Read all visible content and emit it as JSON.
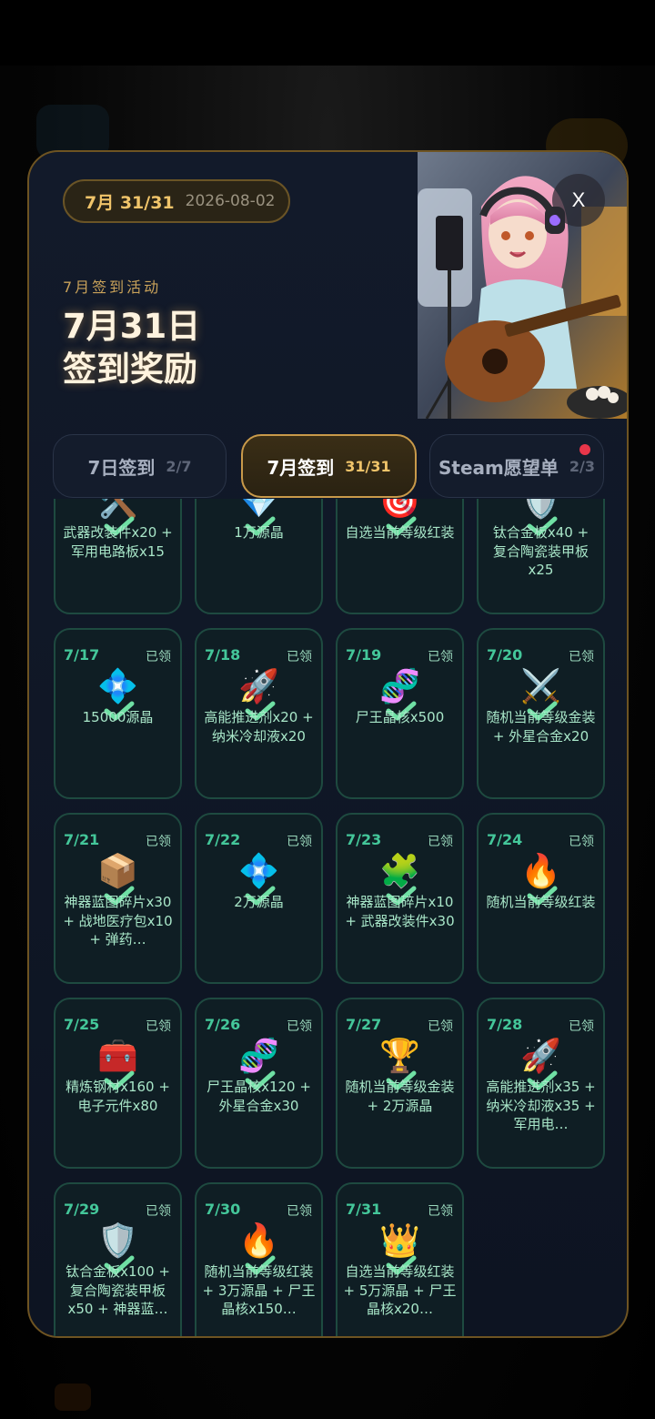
{
  "dialog": {
    "close_label": "X",
    "date_pill": {
      "month_progress": "7月 31/31",
      "date": "2026-08-02"
    },
    "event_label": "7月签到活动",
    "title_line1": "7月31日",
    "title_line2": "签到奖励"
  },
  "tabs": [
    {
      "label": "7日签到",
      "count": "2/7",
      "active": false
    },
    {
      "label": "7月签到",
      "count": "31/31",
      "active": true
    },
    {
      "label": "Steam愿望单",
      "count": "2/3",
      "active": false,
      "has_notification_dot": true
    }
  ],
  "colors": {
    "accent_gold": "#f0c46a",
    "claimed_green": "#44c79a",
    "card_border": "#1e4a40",
    "notification_red": "#e8364a"
  },
  "rewards": [
    {
      "day": "",
      "status": "",
      "icon": "🛠️",
      "icon_name": "tools-icon",
      "text": "武器改装件x20 + 军用电路板x15"
    },
    {
      "day": "",
      "status": "",
      "icon": "💎",
      "icon_name": "diamond-icon",
      "text": "1万源晶"
    },
    {
      "day": "",
      "status": "",
      "icon": "🎯",
      "icon_name": "target-icon",
      "text": "自选当前等级红装"
    },
    {
      "day": "",
      "status": "",
      "icon": "🛡️",
      "icon_name": "shield-icon",
      "text": "钛合金板x40 + 复合陶瓷装甲板x25"
    },
    {
      "day": "7/17",
      "status": "已领",
      "icon": "💠",
      "icon_name": "crystal-icon",
      "text": "15000源晶"
    },
    {
      "day": "7/18",
      "status": "已领",
      "icon": "🚀",
      "icon_name": "rocket-icon",
      "text": "高能推进剂x20 + 纳米冷却液x20"
    },
    {
      "day": "7/19",
      "status": "已领",
      "icon": "🧬",
      "icon_name": "dna-icon",
      "text": "尸王晶核x500"
    },
    {
      "day": "7/20",
      "status": "已领",
      "icon": "⚔️",
      "icon_name": "crossed-swords-icon",
      "text": "随机当前等级金装 + 外星合金x20"
    },
    {
      "day": "7/21",
      "status": "已领",
      "icon": "📦",
      "icon_name": "package-icon",
      "text": "神器蓝图碎片x30 + 战地医疗包x10 + 弹药…"
    },
    {
      "day": "7/22",
      "status": "已领",
      "icon": "💠",
      "icon_name": "crystal-icon",
      "text": "2万源晶"
    },
    {
      "day": "7/23",
      "status": "已领",
      "icon": "🧩",
      "icon_name": "puzzle-icon",
      "text": "神器蓝图碎片x10 + 武器改装件x30"
    },
    {
      "day": "7/24",
      "status": "已领",
      "icon": "🔥",
      "icon_name": "fire-icon",
      "text": "随机当前等级红装"
    },
    {
      "day": "7/25",
      "status": "已领",
      "icon": "🧰",
      "icon_name": "toolbox-icon",
      "text": "精炼钢材x160 + 电子元件x80"
    },
    {
      "day": "7/26",
      "status": "已领",
      "icon": "🧬",
      "icon_name": "dna-icon",
      "text": "尸王晶核x120 + 外星合金x30"
    },
    {
      "day": "7/27",
      "status": "已领",
      "icon": "🏆",
      "icon_name": "trophy-icon",
      "text": "随机当前等级金装 + 2万源晶"
    },
    {
      "day": "7/28",
      "status": "已领",
      "icon": "🚀",
      "icon_name": "rocket-icon",
      "text": "高能推进剂x35 + 纳米冷却液x35 + 军用电…"
    },
    {
      "day": "7/29",
      "status": "已领",
      "icon": "🛡️",
      "icon_name": "shield-icon",
      "text": "钛合金板x100 + 复合陶瓷装甲板x50 + 神器蓝…"
    },
    {
      "day": "7/30",
      "status": "已领",
      "icon": "🔥",
      "icon_name": "fire-icon",
      "text": "随机当前等级红装 + 3万源晶 + 尸王晶核x150…"
    },
    {
      "day": "7/31",
      "status": "已领",
      "icon": "👑",
      "icon_name": "crown-icon",
      "text": "自选当前等级红装 + 5万源晶 + 尸王晶核x20…"
    }
  ]
}
